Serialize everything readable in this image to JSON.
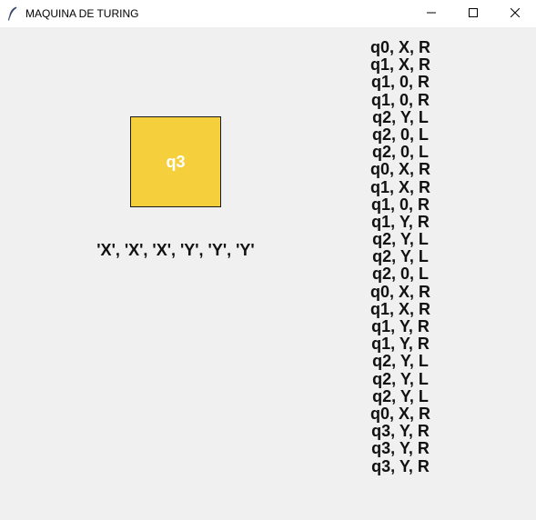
{
  "window": {
    "title": "MAQUINA DE TURING",
    "icon": "feather-icon",
    "controls": [
      "minimize-icon",
      "maximize-icon",
      "close-icon"
    ]
  },
  "machine": {
    "current_state": "q3",
    "state_color": "#f5d03c",
    "tape": "'X', 'X', 'X', 'Y', 'Y', 'Y'"
  },
  "transitions": [
    "q0, X, R",
    "q1, X, R",
    "q1, 0, R",
    "q1, 0, R",
    "q2, Y, L",
    "q2, 0, L",
    "q2, 0, L",
    "q0, X, R",
    "q1, X, R",
    "q1, 0, R",
    "q1, Y, R",
    "q2, Y, L",
    "q2, Y, L",
    "q2, 0, L",
    "q0, X, R",
    "q1, X, R",
    "q1, Y, R",
    "q1, Y, R",
    "q2, Y, L",
    "q2, Y, L",
    "q2, Y, L",
    "q0, X, R",
    "q3, Y, R",
    "q3, Y, R",
    "q3, Y, R"
  ]
}
